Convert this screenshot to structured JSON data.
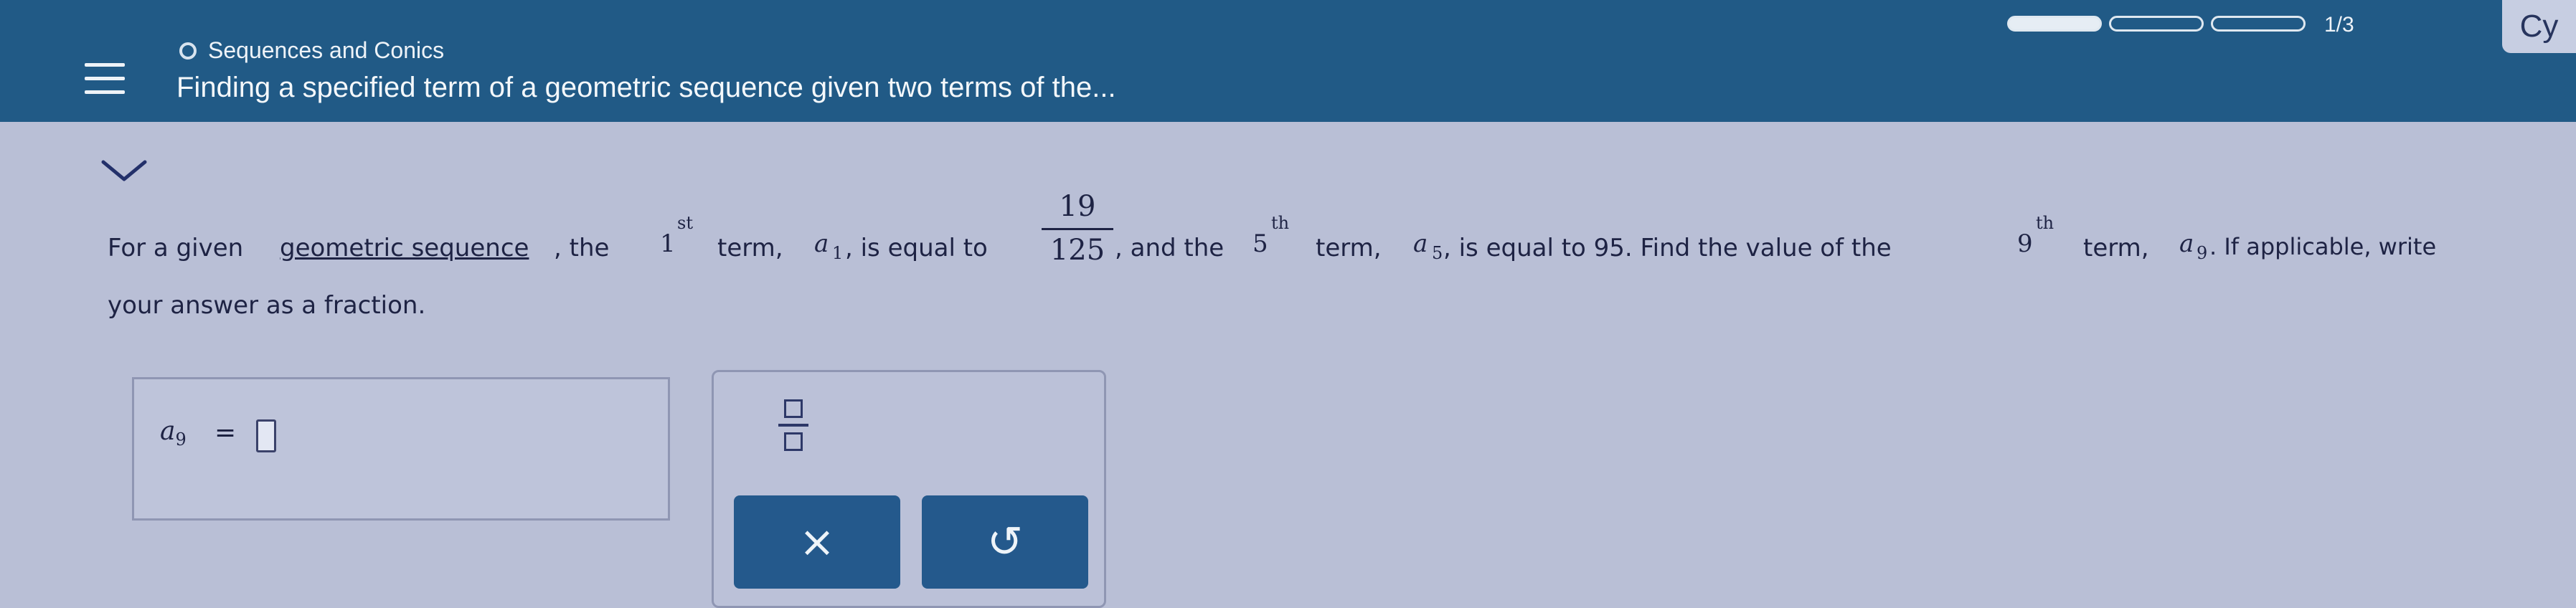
{
  "header": {
    "topic": "Sequences and Conics",
    "title": "Finding a specified term of a geometric sequence given two terms of the...",
    "progress_text": "1/3",
    "progress": {
      "filled_segments": 1,
      "total_segments": 3
    },
    "corner_label": "Cy"
  },
  "problem": {
    "p1": "For a given",
    "p1_link": "geometric sequence",
    "p1b": ", the",
    "first_num": "1",
    "first_sup": "st",
    "p2": "term,",
    "a1_var": "a",
    "a1_sub": "1",
    "p3": ", is equal to",
    "frac_num": "19",
    "frac_den": "125",
    "p4": ", and the",
    "fifth_num": "5",
    "fifth_sup": "th",
    "p5": "term,",
    "a5_var": "a",
    "a5_sub": "5",
    "p6": ", is equal to 95. Find the value of the",
    "ninth_num": "9",
    "ninth_sup": "th",
    "p7": "term,",
    "a9_var": "a",
    "a9_sub": "9",
    "p8": ". If applicable, write",
    "line2": "your answer as a fraction."
  },
  "answer": {
    "var": "a",
    "sub": "9",
    "equals": "=",
    "value": ""
  },
  "tools": {
    "clear_label": "×",
    "undo_label": "↺"
  }
}
